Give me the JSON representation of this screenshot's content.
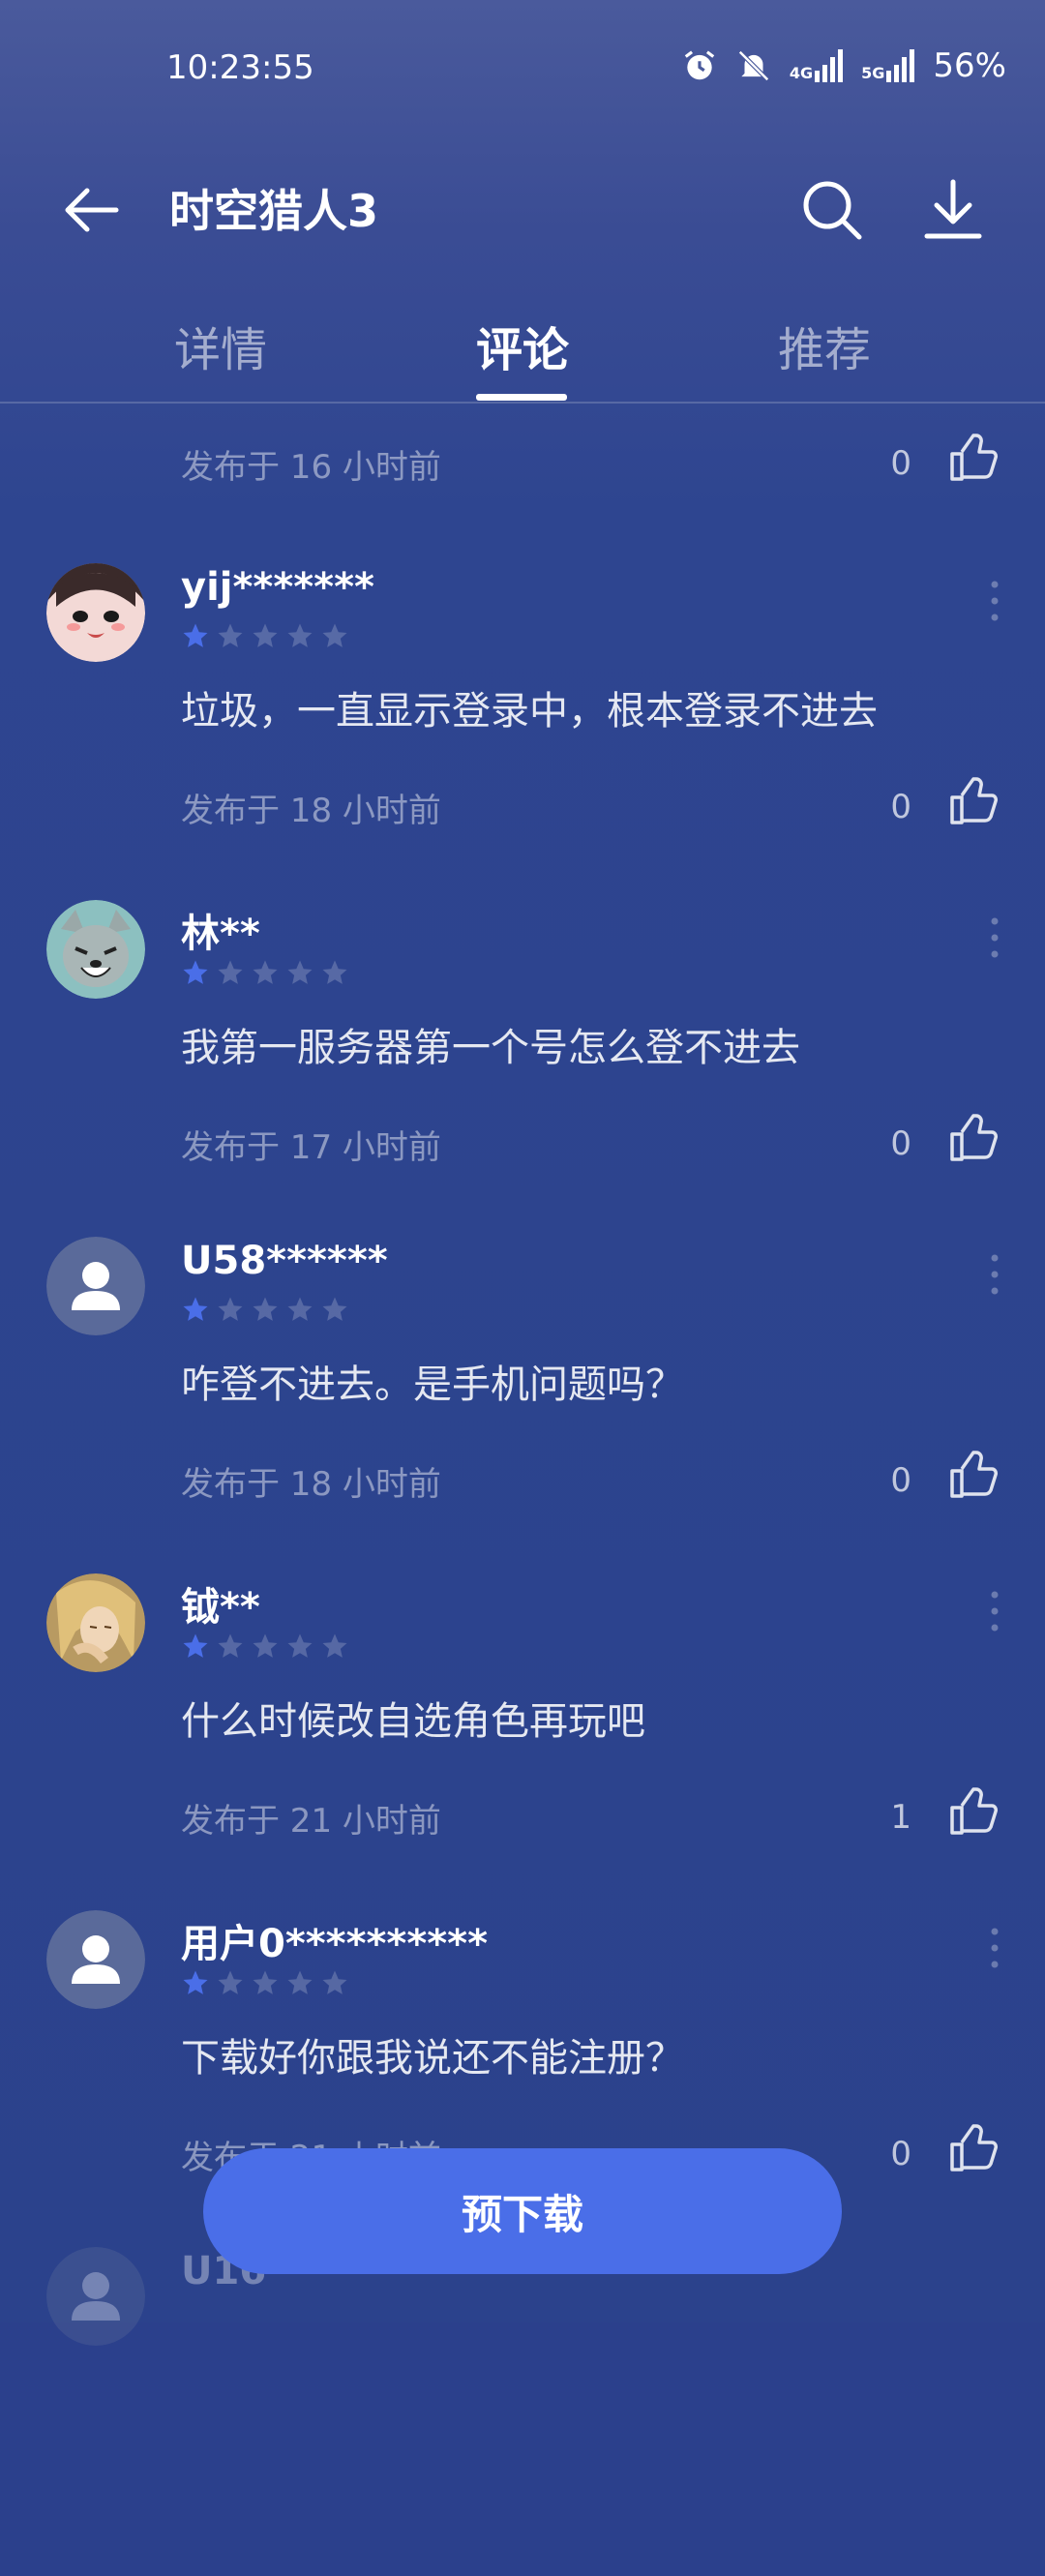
{
  "status_bar": {
    "time": "10:23:55",
    "network_4g": "4G",
    "network_5g": "5G",
    "battery": "56%"
  },
  "header": {
    "title": "时空猎人3"
  },
  "tabs": [
    {
      "label": "详情",
      "active": false
    },
    {
      "label": "评论",
      "active": true
    },
    {
      "label": "推荐",
      "active": false
    }
  ],
  "top_partial": {
    "time": "发布于 16 小时前",
    "likes": "0"
  },
  "comments": [
    {
      "username": "yij*******",
      "rating": 1,
      "text": "垃圾，一直显示登录中，根本登录不进去",
      "time": "发布于 18 小时前",
      "likes": "0",
      "avatar": "anime-girl-avatar"
    },
    {
      "username": "林**",
      "rating": 1,
      "text": "我第一服务器第一个号怎么登不进去",
      "time": "发布于 17 小时前",
      "likes": "0",
      "avatar": "wolf-avatar"
    },
    {
      "username": "U58******",
      "rating": 1,
      "text": "咋登不进去。是手机问题吗？",
      "time": "发布于 18 小时前",
      "likes": "0",
      "avatar": "default-user-avatar"
    },
    {
      "username": "钺**",
      "rating": 1,
      "text": "什么时候改自选角色再玩吧",
      "time": "发布于 21 小时前",
      "likes": "1",
      "avatar": "blonde-character-avatar"
    },
    {
      "username": "用户0**********",
      "rating": 1,
      "text": "下载好你跟我说还不能注册？",
      "time": "发布于 21 小时前",
      "likes": "0",
      "avatar": "default-user-avatar"
    }
  ],
  "bottom_partial": {
    "username": "U16"
  },
  "cta": {
    "label": "预下载"
  },
  "colors": {
    "accent": "#4a6ee8",
    "star_filled": "#4a6ee8",
    "background": "#2b428c"
  }
}
